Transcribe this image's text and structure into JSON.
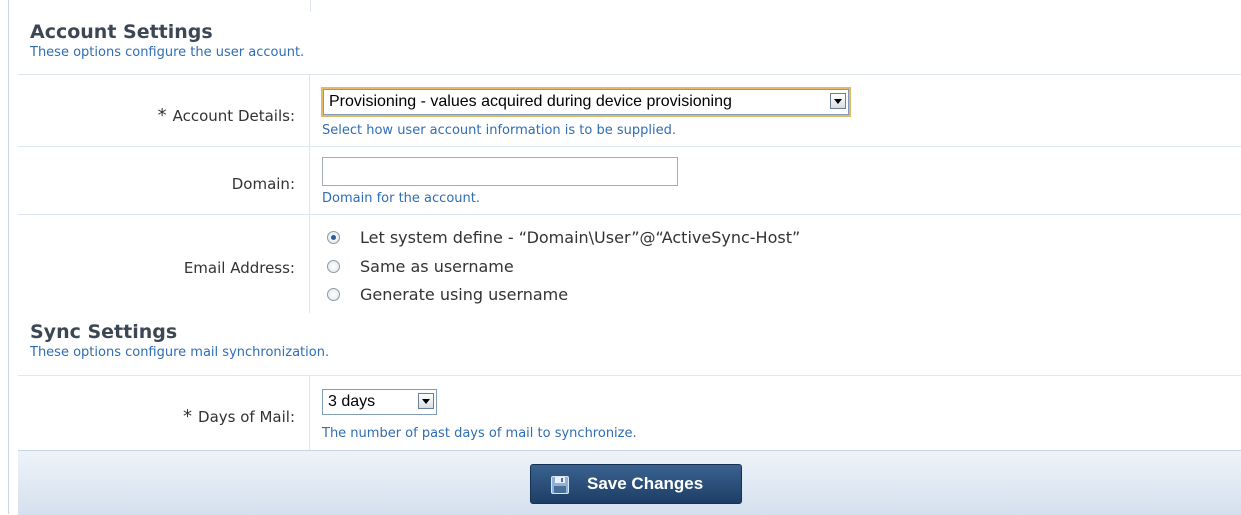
{
  "account_section": {
    "title": "Account Settings",
    "description": "These options configure the user account."
  },
  "account_details": {
    "required_mark": "*",
    "label": "Account Details:",
    "selected": "Provisioning - values acquired during device provisioning",
    "hint": "Select how user account information is to be supplied."
  },
  "domain": {
    "label": "Domain:",
    "value": "",
    "hint": "Domain for the account."
  },
  "email_address": {
    "label": "Email Address:",
    "options": [
      {
        "label": "Let system define - “Domain\\User”@“ActiveSync-Host”",
        "selected": true
      },
      {
        "label": "Same as username",
        "selected": false
      },
      {
        "label": "Generate using username",
        "selected": false
      }
    ]
  },
  "sync_section": {
    "title": "Sync Settings",
    "description": "These options configure mail synchronization."
  },
  "days_of_mail": {
    "required_mark": "*",
    "label": "Days of Mail:",
    "selected": "3 days",
    "hint": "The number of past days of mail to synchronize."
  },
  "footer": {
    "save_label": "Save Changes",
    "save_icon": "floppy-disk-icon"
  },
  "colors": {
    "hint_blue": "#2f6db5",
    "button_navy": "#2a4d78",
    "focus_outline": "#e5b76a"
  }
}
